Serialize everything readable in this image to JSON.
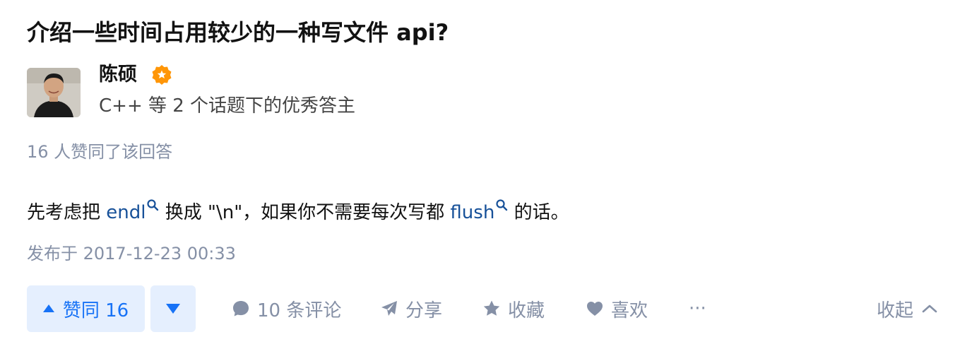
{
  "question": {
    "title": "介绍一些时间占用较少的一种写文件 api?"
  },
  "author": {
    "name": "陈硕",
    "badge_icon": "verified-badge-icon",
    "description": "C++ 等 2 个话题下的优秀答主"
  },
  "answer": {
    "vote_summary": "16 人赞同了该回答",
    "body": {
      "part1": "先考虑把 ",
      "link1": "endl",
      "part2": " 换成 \"\\n\"，如果你不需要每次写都 ",
      "link2": "flush",
      "part3": " 的话。"
    },
    "publish_time": "发布于 2017-12-23 00:33"
  },
  "actions": {
    "upvote_label": "赞同 16",
    "comments_label": "10 条评论",
    "share_label": "分享",
    "favorite_label": "收藏",
    "like_label": "喜欢",
    "more_label": "···",
    "collapse_label": "收起"
  },
  "colors": {
    "accent": "#1772f6",
    "accent_bg": "#e5effe",
    "muted": "#8590a6",
    "link": "#175199",
    "badge": "#ff9607"
  }
}
